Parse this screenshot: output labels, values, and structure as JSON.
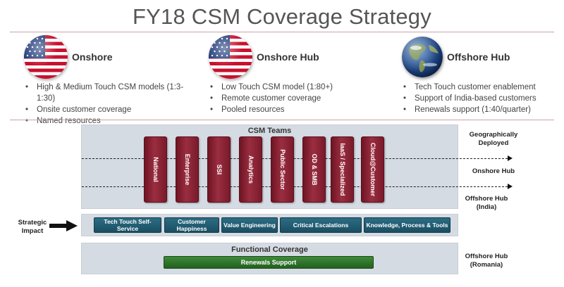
{
  "title": "FY18 CSM Coverage Strategy",
  "columns": [
    {
      "name": "Onshore",
      "icon": "us-flag-icon",
      "bullets": [
        "High & Medium Touch CSM models (1:3-1:30)",
        "Onsite customer coverage",
        "Named resources"
      ]
    },
    {
      "name": "Onshore Hub",
      "icon": "us-flag-icon",
      "bullets": [
        "Low Touch CSM model (1:80+)",
        "Remote customer coverage",
        "Pooled resources"
      ]
    },
    {
      "name": "Offshore Hub",
      "icon": "globe-icon",
      "bullets": [
        "Tech Touch customer enablement",
        "Support of India-based customers",
        "Renewals support (1:40/quarter)"
      ]
    }
  ],
  "csm_teams": {
    "title": "CSM Teams",
    "teams": [
      "National",
      "Enterprise",
      "SSI",
      "Analytics",
      "Public Sector",
      "OD & SMB",
      "IaaS / Specialized",
      "Cloud@Customer"
    ]
  },
  "side_labels": {
    "geo": "Geographically Deployed",
    "onshore_hub": "Onshore Hub",
    "offshore_india": "Offshore Hub (India)",
    "offshore_romania": "Offshore Hub (Romania)"
  },
  "strategic_impact": {
    "label": "Strategic Impact",
    "items": [
      "Tech Touch Self-Service",
      "Customer Happiness",
      "Value Engineering",
      "Critical Escalations",
      "Knowledge, Process &  Tools"
    ]
  },
  "functional_coverage": {
    "title": "Functional Coverage",
    "renewals": "Renewals Support"
  },
  "colors": {
    "team_maroon": "#7a1a2b",
    "impact_teal": "#1f5a70",
    "renewals_green": "#2f7a2a",
    "panel_gray": "#d5dbe2"
  }
}
